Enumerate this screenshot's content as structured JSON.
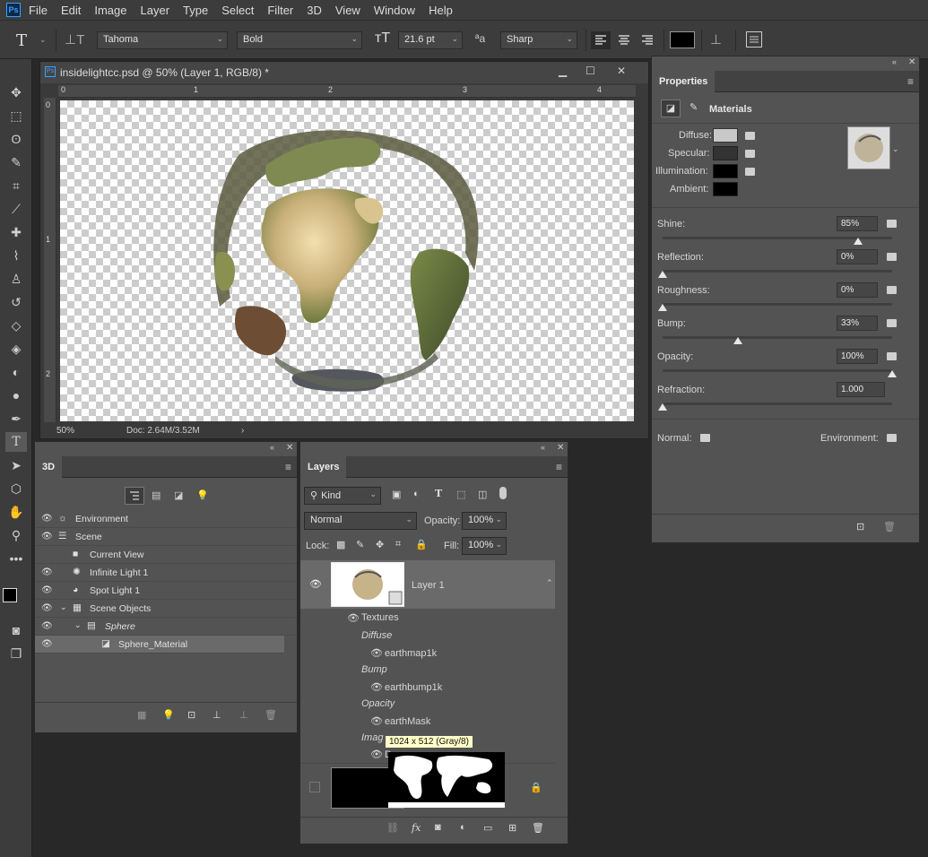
{
  "menubar": {
    "logo": "Ps",
    "items": [
      "File",
      "Edit",
      "Image",
      "Layer",
      "Type",
      "Select",
      "Filter",
      "3D",
      "View",
      "Window",
      "Help"
    ]
  },
  "options": {
    "font_family": "Tahoma",
    "font_style": "Bold",
    "font_size": "21.6 pt",
    "antialias": "Sharp"
  },
  "document": {
    "title": "insidelightcc.psd @ 50% (Layer 1, RGB/8) *",
    "zoom": "50%",
    "doc_info": "Doc: 2.64M/3.52M",
    "ruler_h": [
      "0",
      "1",
      "2",
      "3",
      "4"
    ],
    "ruler_v": [
      "0",
      "1",
      "2"
    ]
  },
  "panel3d": {
    "tab": "3D",
    "items": [
      "Environment",
      "Scene",
      "Current View",
      "Infinite Light 1",
      "Spot Light 1",
      "Scene Objects",
      "Sphere",
      "Sphere_Material"
    ]
  },
  "layers": {
    "tab": "Layers",
    "kind": "Kind",
    "blend": "Normal",
    "opacity_label": "Opacity:",
    "opacity": "100%",
    "lock_label": "Lock:",
    "fill_label": "Fill:",
    "fill": "100%",
    "layer_name": "Layer 1",
    "textures": "Textures",
    "diffuse": "Diffuse",
    "earthmap": "earthmap1k",
    "bump": "Bump",
    "earthbump": "earthbump1k",
    "opacity_tex": "Opacity",
    "earthmask": "earthMask",
    "image_partial": "Imag",
    "default_partial": "De",
    "tooltip": "1024 x 512 (Gray/8)"
  },
  "properties": {
    "title": "Properties",
    "section": "Materials",
    "diffuse": "Diffuse:",
    "specular": "Specular:",
    "illumination": "Illumination:",
    "ambient": "Ambient:",
    "shine_label": "Shine:",
    "shine": "85%",
    "shine_level": 0.85,
    "reflection_label": "Reflection:",
    "reflection": "0%",
    "reflection_level": 0,
    "roughness_label": "Roughness:",
    "roughness": "0%",
    "roughness_level": 0,
    "bump_label": "Bump:",
    "bump": "33%",
    "bump_level": 0.33,
    "opacity_label": "Opacity:",
    "opacity": "100%",
    "opacity_level": 1,
    "refraction_label": "Refraction:",
    "refraction": "1.000",
    "refraction_level": 0,
    "normal": "Normal:",
    "environment": "Environment:"
  }
}
